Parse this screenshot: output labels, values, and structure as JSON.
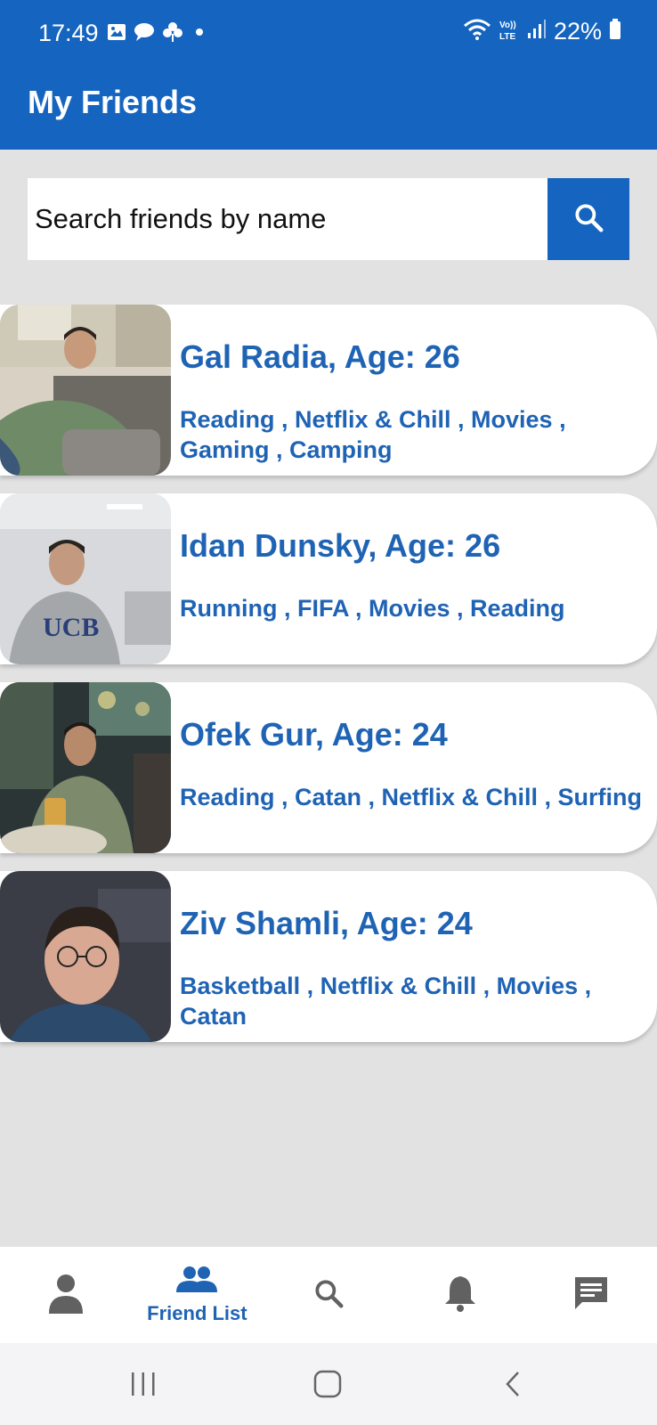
{
  "status_bar": {
    "time": "17:49",
    "battery": "22%",
    "network": "LTE"
  },
  "header": {
    "title": "My Friends"
  },
  "search": {
    "placeholder": "Search friends by name"
  },
  "friends": [
    {
      "name": "Gal Radia, Age: 26",
      "hobbies": "Reading , Netflix & Chill , Movies , Gaming , Camping"
    },
    {
      "name": "Idan Dunsky, Age: 26",
      "hobbies": "Running , FIFA , Movies , Reading"
    },
    {
      "name": "Ofek Gur, Age: 24",
      "hobbies": "Reading , Catan , Netflix & Chill , Surfing"
    },
    {
      "name": "Ziv Shamli, Age: 24",
      "hobbies": "Basketball , Netflix & Chill , Movies , Catan"
    }
  ],
  "bottom_nav": {
    "items": [
      {
        "icon": "person-icon"
      },
      {
        "icon": "group-icon",
        "label": "Friend List"
      },
      {
        "icon": "search-icon"
      },
      {
        "icon": "bell-icon"
      },
      {
        "icon": "chat-icon"
      }
    ]
  },
  "colors": {
    "primary": "#1565c0",
    "text_accent": "#1f63b4",
    "background": "#e2e2e2"
  }
}
